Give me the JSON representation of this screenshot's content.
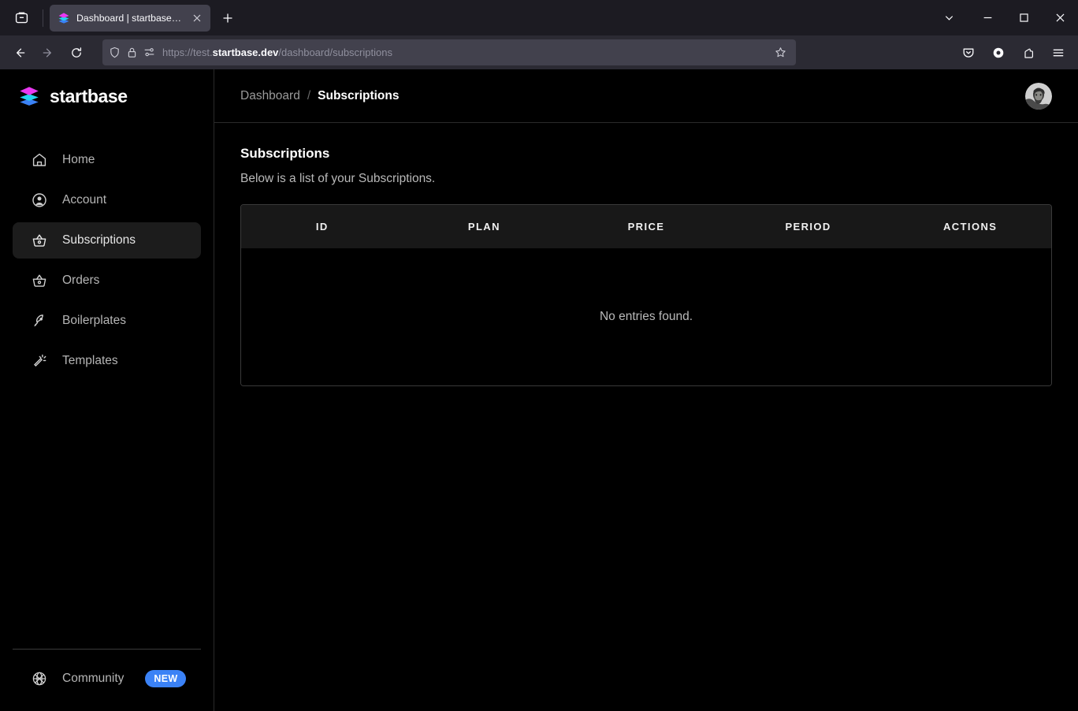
{
  "browser": {
    "tab": {
      "title": "Dashboard | startbase.dev",
      "favicon_name": "startbase-layers-favicon",
      "close_label": "×"
    },
    "newtab_label": "+",
    "tab_list_icon": "tab-list-icon",
    "nav": {
      "back_icon": "back-arrow-icon",
      "forward_icon": "forward-arrow-icon",
      "reload_icon": "reload-icon"
    },
    "urlbar": {
      "shield_icon": "tracking-protection-shield-icon",
      "lock_icon": "padlock-icon",
      "permissions_icon": "site-permissions-icon",
      "url_prefix": "https://test.",
      "url_domain": "startbase.dev",
      "url_path": "/dashboard/subscriptions",
      "bookmark_icon": "bookmark-star-icon"
    },
    "toolbar_right": {
      "pocket_icon": "pocket-save-icon",
      "account_icon": "firefox-account-icon",
      "extensions_icon": "extensions-icon",
      "menu_icon": "hamburger-menu-icon"
    },
    "window_controls": {
      "chevron_icon": "chevron-down-icon",
      "minimize_icon": "minimize-icon",
      "maximize_icon": "maximize-icon",
      "close_icon": "window-close-icon"
    }
  },
  "sidebar": {
    "brand": {
      "name": "startbase",
      "logo_icon": "startbase-layers-logo"
    },
    "items": [
      {
        "label": "Home",
        "icon": "home-icon",
        "active": false
      },
      {
        "label": "Account",
        "icon": "user-circle-icon",
        "active": false
      },
      {
        "label": "Subscriptions",
        "icon": "basket-icon",
        "active": true
      },
      {
        "label": "Orders",
        "icon": "basket-icon",
        "active": false
      },
      {
        "label": "Boilerplates",
        "icon": "rocket-icon",
        "active": false
      },
      {
        "label": "Templates",
        "icon": "magic-wand-icon",
        "active": false
      }
    ],
    "community": {
      "label": "Community",
      "icon": "globe-icon",
      "badge": "NEW",
      "badge_color": "#3b82f6"
    }
  },
  "header": {
    "breadcrumb": {
      "root": "Dashboard",
      "separator": "/",
      "current": "Subscriptions"
    },
    "avatar_name": "user-avatar"
  },
  "main": {
    "title": "Subscriptions",
    "subtitle": "Below is a list of your Subscriptions.",
    "table": {
      "columns": [
        "ID",
        "PLAN",
        "PRICE",
        "PERIOD",
        "ACTIONS"
      ],
      "rows": [],
      "empty_message": "No entries found."
    }
  },
  "colors": {
    "accent_blue": "#3b82f6",
    "logo_magenta": "#e838f0",
    "logo_cyan": "#22d3ee",
    "logo_blue": "#3b82f6",
    "page_bg": "#000000",
    "header_row_bg": "#181818"
  }
}
